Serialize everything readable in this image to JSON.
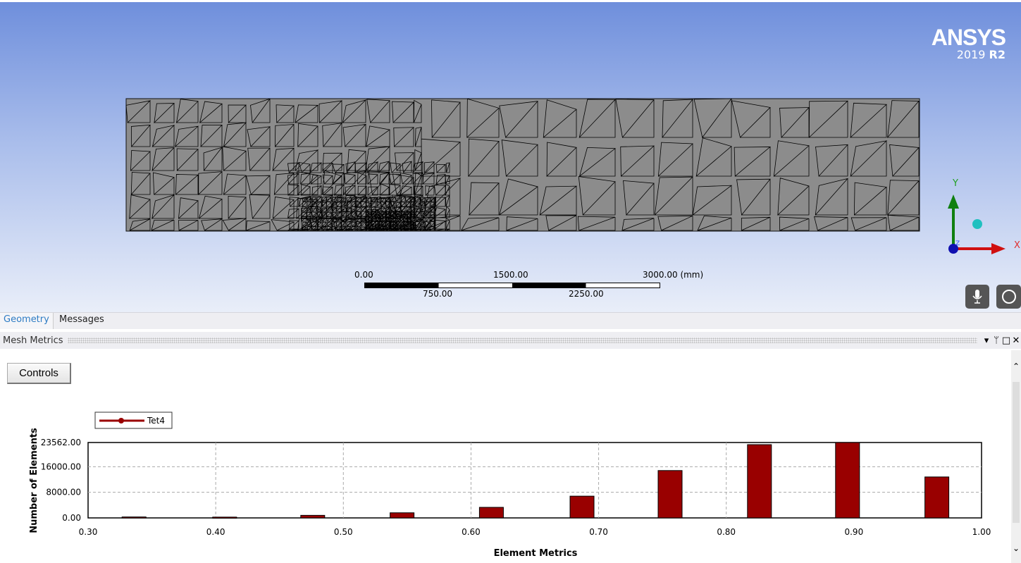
{
  "logo": {
    "brand": "ANSYS",
    "version": "2019",
    "release": "R2"
  },
  "scale_bar": {
    "top_labels": [
      "0.00",
      "1500.00",
      "3000.00 (mm)"
    ],
    "bottom_labels": [
      "750.00",
      "2250.00"
    ]
  },
  "triad": {
    "x": "X",
    "y": "Y",
    "z": "Z",
    "colors": {
      "x": "#d01010",
      "y": "#108010",
      "z": "#1010b0"
    }
  },
  "viewport_buttons": [
    {
      "icon": "microphone-icon"
    },
    {
      "icon": "rotate-icon"
    }
  ],
  "tabs": [
    {
      "label": "Geometry",
      "active": true
    },
    {
      "label": "Messages",
      "active": false
    }
  ],
  "panel": {
    "title": "Mesh Metrics",
    "controls": [
      "dropdown-icon",
      "pin-icon",
      "maximize-icon",
      "close-icon"
    ]
  },
  "controls_button": "Controls",
  "chart_data": {
    "type": "bar",
    "legend": [
      "Tet4"
    ],
    "legend_placement": "top-left",
    "xlabel": "Element Metrics",
    "ylabel": "Number of Elements",
    "xlim": [
      0.3,
      1.0
    ],
    "ylim": [
      0,
      23562
    ],
    "xticks": [
      "0.30",
      "0.40",
      "0.50",
      "0.60",
      "0.70",
      "0.80",
      "0.90",
      "1.00"
    ],
    "yticks": [
      "0.00",
      "8000.00",
      "16000.00",
      "23562.00"
    ],
    "grid": true,
    "bar_color": "#990000",
    "series": [
      {
        "name": "Tet4",
        "x": [
          0.336,
          0.407,
          0.476,
          0.546,
          0.616,
          0.687,
          0.756,
          0.826,
          0.895,
          0.965
        ],
        "values": [
          300,
          250,
          800,
          1600,
          3300,
          6800,
          14800,
          22900,
          23562,
          12800
        ]
      }
    ]
  }
}
